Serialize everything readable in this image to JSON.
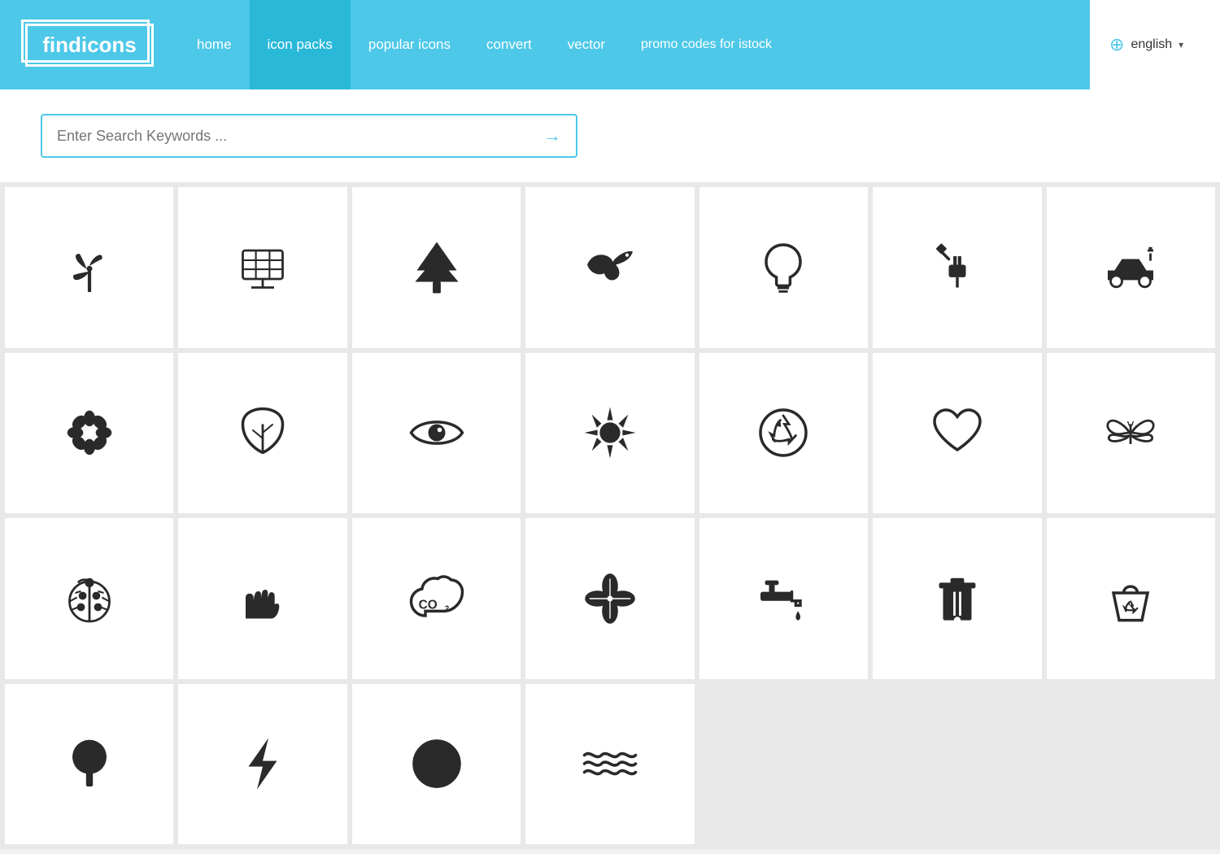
{
  "header": {
    "logo": "findicons",
    "nav": [
      {
        "label": "home",
        "id": "home",
        "active": false
      },
      {
        "label": "icon packs",
        "id": "icon-packs",
        "active": true
      },
      {
        "label": "popular icons",
        "id": "popular-icons",
        "active": false
      },
      {
        "label": "convert",
        "id": "convert",
        "active": false
      },
      {
        "label": "vector",
        "id": "vector",
        "active": false
      },
      {
        "label": "promo codes for istock",
        "id": "promo",
        "active": false
      }
    ],
    "language": "english"
  },
  "search": {
    "placeholder": "Enter Search Keywords ..."
  },
  "icons": {
    "rows": [
      [
        "wind-turbine",
        "solar-panel",
        "pine-tree",
        "bird",
        "light-bulb",
        "plug",
        "electric-car"
      ],
      [
        "flower",
        "leaf",
        "eye",
        "sun",
        "recycle",
        "heart",
        "butterfly"
      ],
      [
        "ladybug",
        "hand",
        "co2-cloud",
        "four-leaf",
        "faucet",
        "trash-bin",
        "recycle-bag"
      ],
      [
        "tree",
        "lightning",
        "globe",
        "waves",
        "",
        "",
        ""
      ]
    ]
  }
}
